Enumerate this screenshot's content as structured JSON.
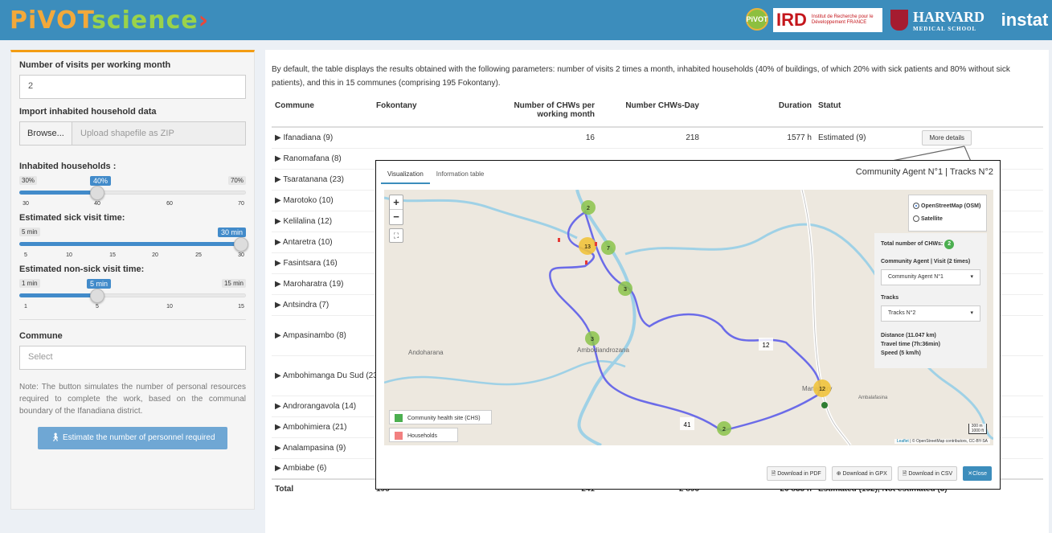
{
  "header": {
    "logo_a": "PiVOT",
    "logo_b": "science",
    "logo_arrow": "›",
    "partners": {
      "pivot": "PiVOT",
      "ird": "IRD",
      "ird_small": "Institut de Recherche pour le Développement FRANCE",
      "harvard": "HARVARD",
      "harvard_small": "MEDICAL SCHOOL",
      "instat": "instat"
    }
  },
  "sidebar": {
    "visits_label": "Number of visits per working month",
    "visits_value": "2",
    "import_label": "Import inhabited household data",
    "browse_label": "Browse...",
    "upload_placeholder": "Upload shapefile as ZIP",
    "households": {
      "label": "Inhabited households :",
      "min": "30%",
      "max": "70%",
      "value": "40%",
      "ticks": [
        "30",
        "40",
        "60",
        "70"
      ]
    },
    "sick": {
      "label": "Estimated sick visit time:",
      "min": "5 min",
      "max": "30 min",
      "value": "30 min",
      "ticks": [
        "5",
        "10",
        "15",
        "20",
        "25",
        "30"
      ]
    },
    "nonsick": {
      "label": "Estimated non-sick visit time:",
      "min": "1 min",
      "max": "15 min",
      "value": "5 min",
      "ticks": [
        "1",
        "5",
        "10",
        "15"
      ]
    },
    "commune_label": "Commune",
    "commune_placeholder": "Select",
    "note": "Note: The button simulates the number of personal resources required to complete the work, based on the communal boundary of the Ifanadiana district.",
    "estimate_button": "Estimate the number of personnel required"
  },
  "main": {
    "intro": "By default, the table displays the results obtained with the following parameters: number of visits 2 times a month, inhabited households (40% of buildings, of which 20% with sick patients and 80% without sick patients), and this in 15 communes (comprising 195 Fokontany).",
    "columns": [
      "Commune",
      "Fokontany",
      "Number of CHWs per working month",
      "Number CHWs-Day",
      "Duration",
      "Statut"
    ],
    "rows": [
      {
        "commune": "Ifanadiana (9)",
        "chws": "16",
        "days": "218",
        "duration": "1577 h",
        "statut": "Estimated (9)"
      },
      {
        "commune": "Ranomafana (8)"
      },
      {
        "commune": "Tsaratanana (23)"
      },
      {
        "commune": "Marotoko (10)"
      },
      {
        "commune": "Kelilalina (12)"
      },
      {
        "commune": "Antaretra (10)"
      },
      {
        "commune": "Fasintsara (16)"
      },
      {
        "commune": "Maroharatra (19)"
      },
      {
        "commune": "Antsindra (7)"
      },
      {
        "commune": "Ampasinambo (8)"
      },
      {
        "commune": "Ambohimanga Du Sud (23)"
      },
      {
        "commune": "Androrangavola (14)"
      },
      {
        "commune": "Ambohimiera (21)"
      },
      {
        "commune": "Analampasina (9)"
      },
      {
        "commune": "Ambiabe (6)"
      }
    ],
    "more_details": "More details",
    "total": {
      "label": "Total",
      "fokontany": "195",
      "chws": "241",
      "days": "2 896",
      "duration": "20 833 h",
      "statut": "Estimated (192), Not estimated (3)"
    }
  },
  "modal": {
    "tabs": [
      "Visualization",
      "Information table"
    ],
    "title": "Community Agent N°1 | Tracks N°2",
    "layers": [
      "OpenStreetMap (OSM)",
      "Satellite"
    ],
    "panel": {
      "total_label": "Total number of CHWs:",
      "total_value": "2",
      "agent_label": "Community Agent | Visit (2 times)",
      "agent_value": "Community Agent N°1",
      "tracks_label": "Tracks",
      "tracks_value": "Tracks N°2",
      "distance": "Distance (11.047 km)",
      "travel": "Travel time (7h:36min)",
      "speed": "Speed (5 km/h)"
    },
    "legend": {
      "chs": "Community health site (CHS)",
      "households": "Households"
    },
    "places": [
      "Andoharana",
      "Ambodiandrozana",
      "Ambalafasina",
      "Mananjary"
    ],
    "clusters": [
      "2",
      "13",
      "7",
      "3",
      "3",
      "12",
      "2"
    ],
    "markers": [
      "12",
      "41"
    ],
    "scale": [
      "300 m",
      "1000 ft"
    ],
    "attribution_a": "Leaflet",
    "attribution_b": " | © OpenStreetMap contributors, CC-BY-SA",
    "buttons": {
      "pdf": "Download in PDF",
      "gpx": "Download in GPX",
      "csv": "Download in CSV",
      "close": "Close"
    }
  }
}
